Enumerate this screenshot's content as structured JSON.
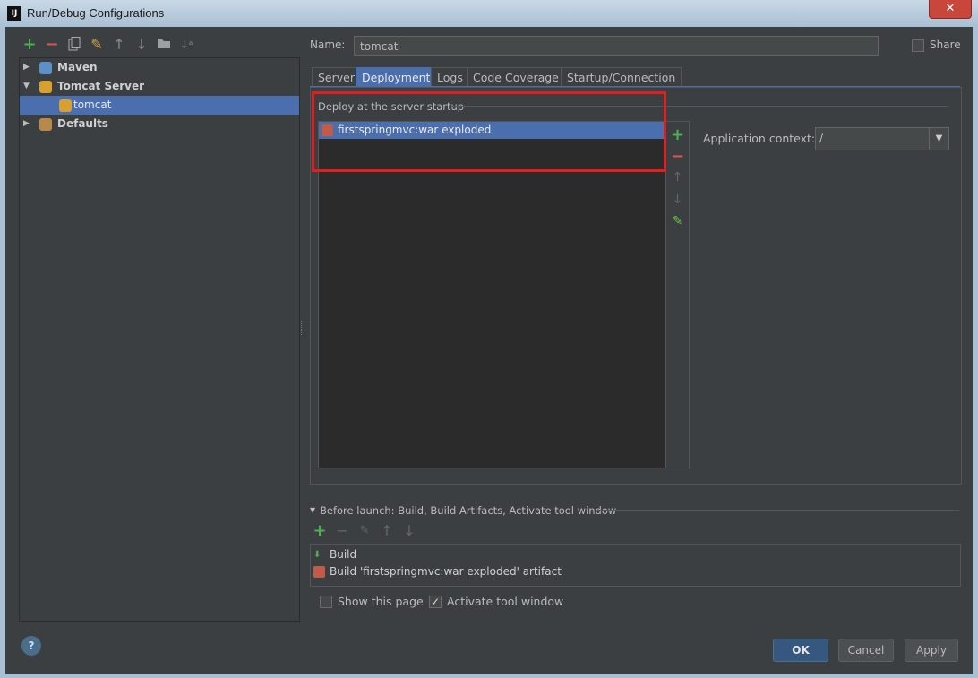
{
  "window": {
    "title": "Run/Debug Configurations",
    "logo_text": "IJ",
    "close_glyph": "✕"
  },
  "toolbar": {
    "icons": [
      "add-icon",
      "remove-icon",
      "copy-icon",
      "wrench-icon",
      "move-up-icon",
      "move-down-icon",
      "folder-icon",
      "sort-icon"
    ]
  },
  "tree": {
    "maven": "Maven",
    "tomcat_server": "Tomcat Server",
    "tomcat": "tomcat",
    "defaults": "Defaults"
  },
  "name_label": "Name:",
  "name_value": "tomcat",
  "share_label": "Share",
  "tabs": [
    "Server",
    "Deployment",
    "Logs",
    "Code Coverage",
    "Startup/Connection"
  ],
  "active_tab": "Deployment",
  "deploy": {
    "header": "Deploy at the server startup",
    "items": [
      "firstspringmvc:war exploded"
    ],
    "app_context_label": "Application context:",
    "app_context_value": "/"
  },
  "before_launch": {
    "header": "Before launch: Build, Build Artifacts, Activate tool window",
    "items": [
      "Build",
      "Build 'firstspringmvc:war exploded' artifact"
    ]
  },
  "options": {
    "show_page": {
      "label": "Show this page",
      "checked": false
    },
    "activate_tool": {
      "label": "Activate tool window",
      "checked": true
    }
  },
  "buttons": {
    "ok": "OK",
    "cancel": "Cancel",
    "apply": "Apply"
  },
  "help": "?",
  "colors": {
    "accent": "#4b6eaf",
    "highlight_box": "#e02020",
    "ok_button": "#365880"
  }
}
